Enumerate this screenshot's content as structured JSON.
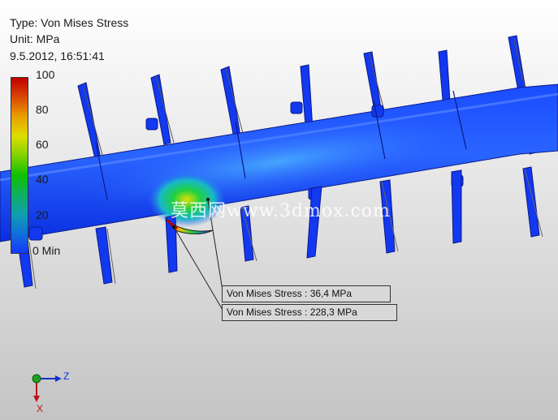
{
  "header": {
    "type_line": "Type: Von Mises Stress",
    "unit_line": "Unit: MPa",
    "date_line": "9.5.2012, 16:51:41"
  },
  "legend": {
    "labels": [
      "100",
      "80",
      "60",
      "40",
      "20",
      "0 Min"
    ],
    "colors": [
      "#c00000",
      "#d94800",
      "#e8a000",
      "#dede00",
      "#7fd200",
      "#10c000",
      "#10b060",
      "#109fb0",
      "#1070d8",
      "#1538ff"
    ]
  },
  "probes": [
    {
      "label": "Von Mises Stress : 36,4 MPa"
    },
    {
      "label": "Von Mises Stress : 228,3 MPa"
    }
  ],
  "watermark": "莫西网www.3dmox.com",
  "axis": {
    "z_label": "Z",
    "x_label": "X"
  },
  "colors": {
    "background_top": "#ffffff",
    "background_bottom": "#c8c8c8",
    "model_blue": "#0a3cf0"
  }
}
